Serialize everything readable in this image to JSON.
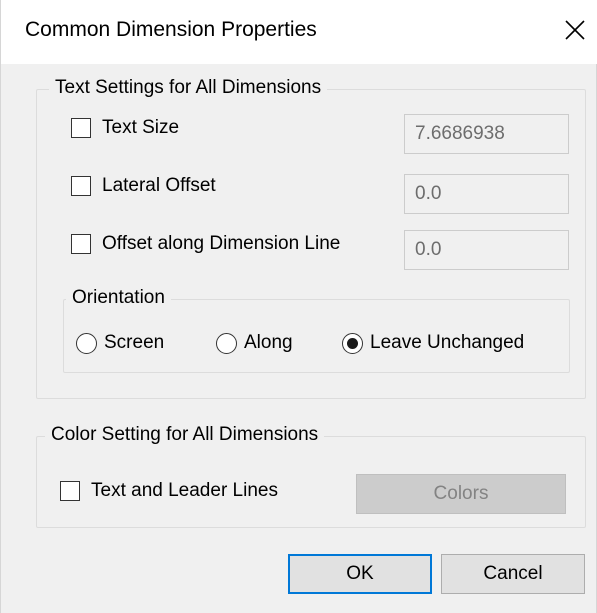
{
  "dialog": {
    "title": "Common Dimension Properties",
    "close_icon": "close-icon"
  },
  "text_settings": {
    "group_label": "Text Settings for All Dimensions",
    "text_size": {
      "label": "Text Size",
      "checked": false,
      "value": "7.6686938"
    },
    "lateral_offset": {
      "label": "Lateral Offset",
      "checked": false,
      "value": "0.0"
    },
    "offset_along": {
      "label": "Offset along Dimension Line",
      "checked": false,
      "value": "0.0"
    },
    "orientation": {
      "group_label": "Orientation",
      "options": [
        {
          "label": "Screen",
          "selected": false
        },
        {
          "label": "Along",
          "selected": false
        },
        {
          "label": "Leave Unchanged",
          "selected": true
        }
      ]
    }
  },
  "color_settings": {
    "group_label": "Color Setting for All Dimensions",
    "text_and_leader": {
      "label": "Text and Leader Lines",
      "checked": false
    },
    "colors_button": "Colors"
  },
  "buttons": {
    "ok": "OK",
    "cancel": "Cancel"
  },
  "colors": {
    "dialog_bg": "#f0f0f0",
    "titlebar_bg": "#ffffff",
    "default_button_border": "#0078d7",
    "disabled_text": "#838383"
  }
}
